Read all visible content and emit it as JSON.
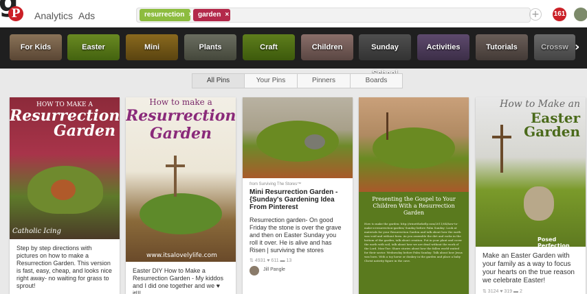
{
  "header": {
    "logo_letter": "P",
    "overflow_glyph": "g",
    "nav": [
      "Analytics",
      "Ads"
    ],
    "search_chips": [
      {
        "label": "resurrection",
        "color": "#8dbc3f"
      },
      {
        "label": "garden",
        "color": "#b3294a"
      }
    ],
    "chip_close": "×",
    "add_glyph": "+",
    "notification_count": "161"
  },
  "categories": [
    "For Kids",
    "Easter",
    "Mini",
    "Plants",
    "Craft",
    "Children",
    "Sunday School",
    "Activities",
    "Tutorials",
    "Crossw"
  ],
  "category_arrow": "›",
  "filter_tabs": {
    "items": [
      "All Pins",
      "Your Pins",
      "Pinners",
      "Boards"
    ],
    "active": "All Pins"
  },
  "pins": [
    {
      "image_text": {
        "line1": "HOW TO MAKE A",
        "line2": "Resurrection",
        "line3": "Garden",
        "credit": "Catholic Icing"
      },
      "description": "Step by step directions with pictures on how to make a Resurrection Garden. This version is fast, easy, cheap, and looks nice right away- no waiting for grass to sprout!"
    },
    {
      "image_text": {
        "line1": "How to make a",
        "line2": "Resurrection",
        "line3": "Garden",
        "credit": "www.itsalovelylife.com"
      },
      "description": "Easter DIY How to Make a Resurrection Garden - My kiddos and I did one together and we ♥ it!!!"
    },
    {
      "source": "from Surviving The Stores™",
      "title": "Mini Resurrection Garden - {Sunday's Gardening Idea From Pinterest",
      "description": "Resurrection garden- On good Friday the stone is over the grave and then on Easter Sunday you roll it over. He is alive and has Risen | surviving the stores",
      "stats": "⇅ 4931 ♥ 611 ▬ 13",
      "pinner": "Jill Pangle"
    },
    {
      "image_text": {
        "heading": "Presenting the Gospel to Your Children With a Resurrection Garden",
        "body": "How to make the garden: http://trinetthekelly.com/2011/04/how-to-make-a-resurrection-garden/ Sunday before Palm Sunday: Look at materials for your Resurrection Garden and talk about how the earth was void and without form. As you assemble the dirt and rocks in the bottom of the garden, talk about creation. Put in your plant and cover the earth with soil, talk about how we are dead without the work of the Lord. Mon-Tue: Share stories about how the fallen world waited for their savior. Wednesday before Palm Sunday: Talk about how Jesus was born. With a toy horse or donkey in the garden and place a baby Christ nativity figure in the cave."
      }
    },
    {
      "image_text": {
        "line1": "How to Make an",
        "line2": "Easter",
        "line3": "Garden",
        "credit": "Posed Perfection"
      },
      "description": "Make an Easter Garden with your family as a way to focus your hearts on the true reason we celebrate Easter!",
      "stats": "⇅ 3124 ♥ 319 ▬ 2"
    }
  ],
  "colors": {
    "brand_red": "#cb2027",
    "category_bar": "#1f1f1f",
    "background": "#e9e9e9"
  }
}
